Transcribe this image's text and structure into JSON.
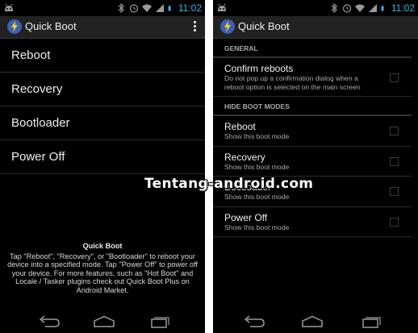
{
  "status": {
    "time": "11:02",
    "accent": "#33b5e5"
  },
  "left": {
    "app_title": "Quick Boot",
    "menu": [
      {
        "label": "Reboot"
      },
      {
        "label": "Recovery"
      },
      {
        "label": "Bootloader"
      },
      {
        "label": "Power Off"
      }
    ],
    "about_title": "Quick Boot",
    "about_text": "Tap \"Reboot\", \"Recovery\", or \"Bootloader\" to reboot your device into a specified mode. Tap \"Power Off\" to power off your device. For more features, such as \"Hot Boot\" and Locale / Tasker plugins check out Quick Boot Plus on Android Market."
  },
  "right": {
    "app_title": "Quick Boot",
    "general_header": "GENERAL",
    "confirm": {
      "title": "Confirm reboots",
      "summary": "Do not pop up a confirmation dialog when a reboot option is selected on the main screen",
      "checked": false
    },
    "hide_header": "HIDE BOOT MODES",
    "modes": [
      {
        "title": "Reboot",
        "summary": "Show this boot mode",
        "checked": false
      },
      {
        "title": "Recovery",
        "summary": "Show this boot mode",
        "checked": false
      },
      {
        "title": "Bootloader",
        "summary": "Show this boot mode",
        "checked": false
      },
      {
        "title": "Power Off",
        "summary": "Show this boot mode",
        "checked": false
      }
    ]
  },
  "icons": {
    "notification": "android-notification-icon",
    "bluetooth": "bluetooth-icon",
    "alarm": "alarm-icon",
    "wifi": "wifi-icon",
    "signal": "signal-icon",
    "battery": "battery-icon",
    "app": "lightning-bolt-icon",
    "overflow": "overflow-menu-icon",
    "back": "back-icon",
    "home": "home-icon",
    "recents": "recent-apps-icon"
  },
  "watermark": "Tentang-android.com"
}
